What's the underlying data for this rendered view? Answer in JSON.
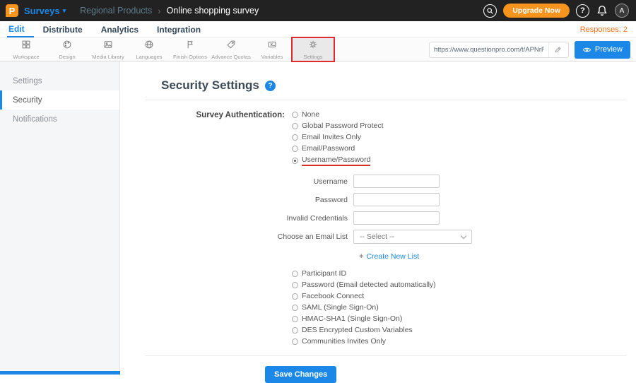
{
  "header": {
    "logo_letter": "P",
    "product": "Surveys",
    "caret": "▾",
    "breadcrumb_parent": "Regional Products",
    "breadcrumb_separator": "›",
    "breadcrumb_current": "Online shopping survey",
    "upgrade_label": "Upgrade Now",
    "help_icon": "?",
    "avatar_letter": "A"
  },
  "nav": {
    "tabs": [
      "Edit",
      "Distribute",
      "Analytics",
      "Integration"
    ],
    "active_tab": "Edit",
    "responses_label": "Responses: 2"
  },
  "toolbar": {
    "items": [
      "Workspace",
      "Design",
      "Media Library",
      "Languages",
      "Finish Options",
      "Advance Quotas",
      "Variables",
      "Settings"
    ],
    "active_item": "Settings",
    "url": "https://www.questionpro.com/t/APNrFZ",
    "preview_label": "Preview"
  },
  "sidebar": {
    "items": [
      "Settings",
      "Security",
      "Notifications"
    ],
    "active_item": "Security"
  },
  "content": {
    "title": "Security Settings",
    "title_help_icon": "?",
    "auth_label": "Survey Authentication:",
    "auth_options": [
      "None",
      "Global Password Protect",
      "Email Invites Only",
      "Email/Password",
      "Username/Password"
    ],
    "selected_option": "Username/Password",
    "field_labels": [
      "Username",
      "Password",
      "Invalid Credentials"
    ],
    "email_list_label": "Choose an Email List",
    "email_list_value": "-- Select --",
    "create_list_plus": "+",
    "create_list_label": "Create New List",
    "more_options": [
      "Participant ID",
      "Password (Email detected automatically)",
      "Facebook Connect",
      "SAML (Single Sign-On)",
      "HMAC-SHA1 (Single Sign-On)",
      "DES Encrypted Custom Variables",
      "Communities Invites Only"
    ],
    "save_label": "Save Changes"
  },
  "colors": {
    "accent_blue": "#1b87e6",
    "brand_orange": "#f7941e",
    "annotation_red": "#e02b2b",
    "topbar_bg": "#222222"
  }
}
